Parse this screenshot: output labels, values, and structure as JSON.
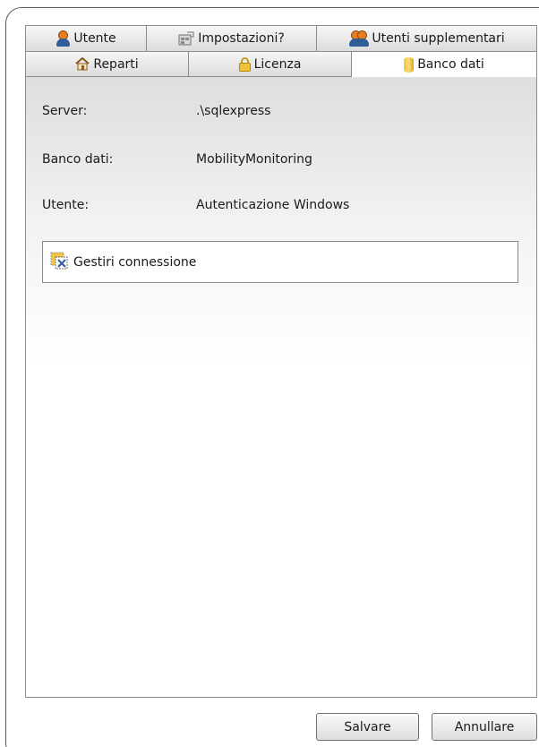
{
  "tabs": {
    "row1": [
      {
        "label": "Utente",
        "icon": "user-icon"
      },
      {
        "label": "Impostazioni?",
        "icon": "settings-icon"
      },
      {
        "label": "Utenti supplementari",
        "icon": "users-icon"
      }
    ],
    "row2": [
      {
        "label": "Reparti",
        "icon": "house-icon"
      },
      {
        "label": "Licenza",
        "icon": "lock-icon"
      },
      {
        "label": "Banco dati",
        "icon": "database-icon",
        "active": true
      }
    ]
  },
  "fields": {
    "server": {
      "label": "Server:",
      "value": ".\\sqlexpress"
    },
    "database": {
      "label": "Banco dati:",
      "value": "MobilityMonitoring"
    },
    "user": {
      "label": "Utente:",
      "value": "Autenticazione Windows"
    }
  },
  "manage_connection": {
    "label": "Gestiri connessione",
    "icon": "connection-icon"
  },
  "footer": {
    "save_label": "Salvare",
    "cancel_label": "Annullare"
  }
}
